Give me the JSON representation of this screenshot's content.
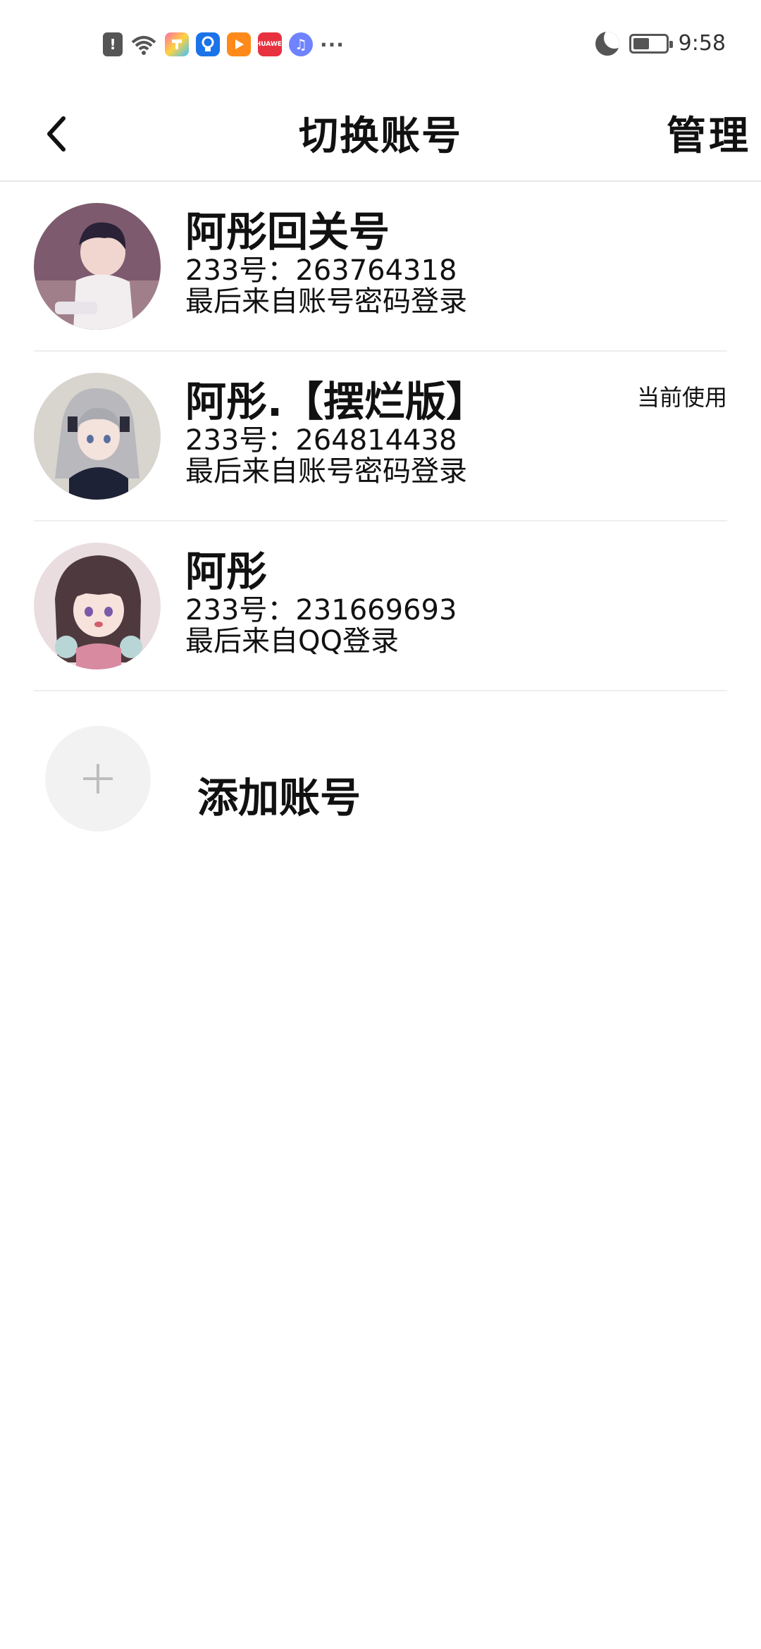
{
  "status_bar": {
    "time": "9:58",
    "app_icons": [
      "alert-icon",
      "wifi-icon",
      "app-icon",
      "lightbulb-app-icon",
      "video-app-icon",
      "huawei-app-icon",
      "music-app-icon"
    ],
    "huawei_label": "HUAWEI",
    "more": "···"
  },
  "header": {
    "title": "切换账号",
    "manage_label": "管理"
  },
  "accounts": [
    {
      "name": "阿彤回关号",
      "id_line": "233号：263764318",
      "source_line": "最后来自账号密码登录",
      "current": false
    },
    {
      "name": "阿彤.【摆烂版】",
      "id_line": "233号：264814438",
      "source_line": "最后来自账号密码登录",
      "current": true,
      "badge": "当前使用"
    },
    {
      "name": "阿彤",
      "id_line": "233号：231669693",
      "source_line": "最后来自QQ登录",
      "current": false
    }
  ],
  "add_account": {
    "label": "添加账号"
  },
  "colors": {
    "background": "#ffffff",
    "divider": "#eeeeee",
    "text": "#111111",
    "add_circle": "#f2f2f2"
  }
}
